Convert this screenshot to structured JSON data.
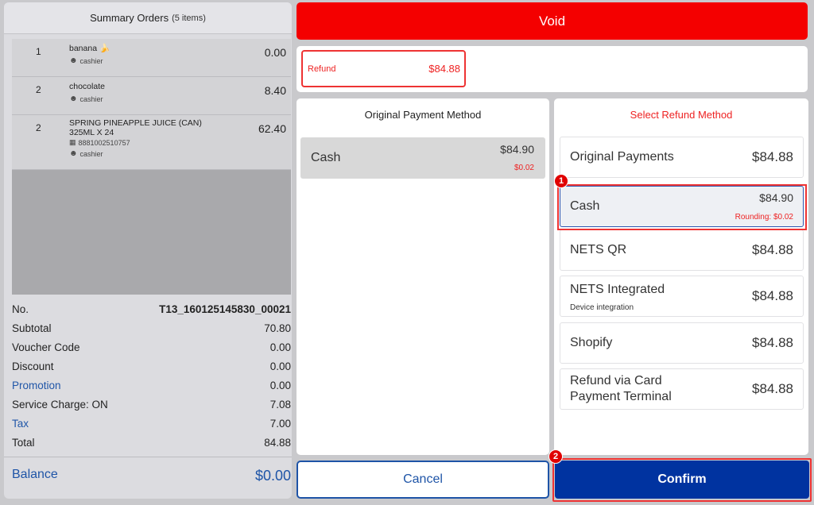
{
  "summary": {
    "title": "Summary Orders",
    "count": "(5 items)",
    "items": [
      {
        "qty": "1",
        "name": "banana 🍌",
        "price": "0.00",
        "staff": "cashier"
      },
      {
        "qty": "2",
        "name": "chocolate",
        "price": "8.40",
        "staff": "cashier"
      },
      {
        "qty": "2",
        "name": "SPRING PINEAPPLE JUICE (CAN) 325ML X 24",
        "price": "62.40",
        "barcode": "8881002510757",
        "staff": "cashier"
      }
    ],
    "no_label": "No.",
    "no_value": "T13_160125145830_00021",
    "rows": [
      {
        "label": "Subtotal",
        "value": "70.80"
      },
      {
        "label": "Voucher Code",
        "value": "0.00"
      },
      {
        "label": "Discount",
        "value": "0.00"
      },
      {
        "label": "Promotion",
        "value": "0.00"
      },
      {
        "label": "Service Charge: ON",
        "value": "7.08"
      },
      {
        "label": "Tax",
        "value": "7.00"
      },
      {
        "label": "Total",
        "value": "84.88"
      }
    ],
    "balance_label": "Balance",
    "balance_value": "$0.00"
  },
  "void_label": "Void",
  "refund": {
    "label": "Refund",
    "value": "$84.88"
  },
  "original": {
    "title": "Original Payment Method",
    "method": "Cash",
    "amount": "$84.90",
    "rounding": "$0.02"
  },
  "select": {
    "title": "Select Refund Method",
    "options": [
      {
        "name": "Original Payments",
        "amount": "$84.88"
      },
      {
        "name": "Cash",
        "amount": "$84.90",
        "rounding": "Rounding: $0.02"
      },
      {
        "name": "NETS QR",
        "amount": "$84.88"
      },
      {
        "name": "NETS Integrated",
        "desc": "Device integration",
        "amount": "$84.88"
      },
      {
        "name": "Shopify",
        "amount": "$84.88"
      },
      {
        "name": "Refund via Card Payment Terminal",
        "amount": "$84.88"
      }
    ]
  },
  "markers": [
    "1",
    "2"
  ],
  "cancel_label": "Cancel",
  "confirm_label": "Confirm",
  "colors": {
    "void": "#f40000",
    "confirm": "#0033a0",
    "accent": "#1e54a7",
    "alert": "#e22222"
  }
}
